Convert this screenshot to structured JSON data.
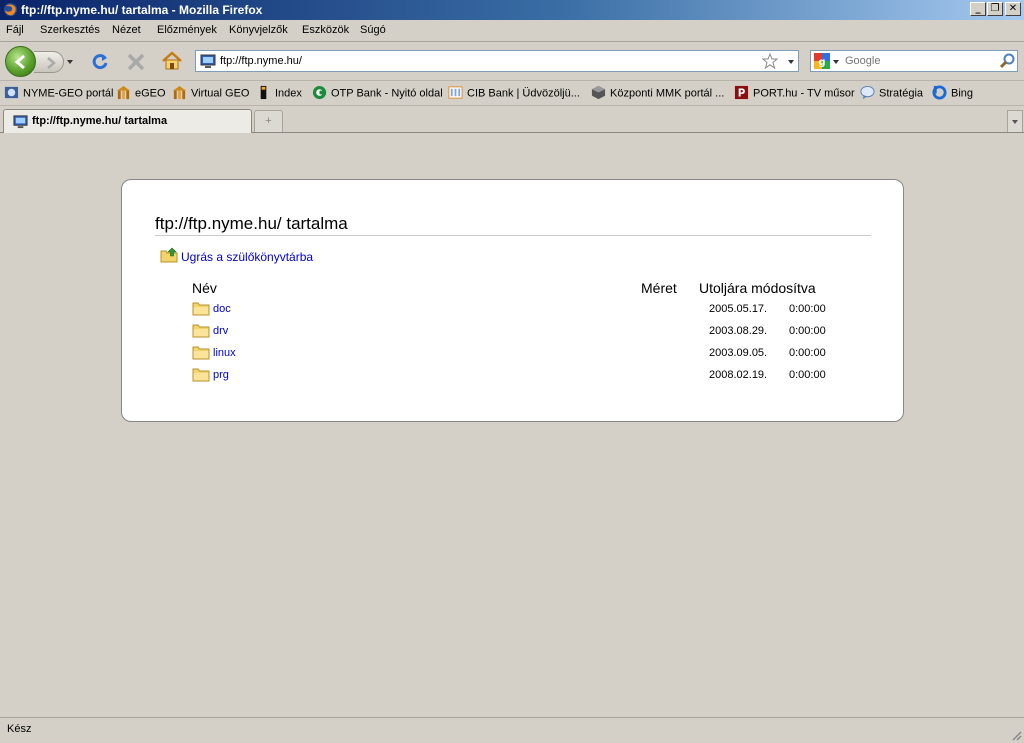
{
  "window": {
    "title": "ftp://ftp.nyme.hu/ tartalma - Mozilla Firefox",
    "minimize_glyph": "_",
    "restore_glyph": "❐",
    "close_glyph": "✕"
  },
  "menu": {
    "items": [
      "Fájl",
      "Szerkesztés",
      "Nézet",
      "Előzmények",
      "Könyvjelzők",
      "Eszközök",
      "Súgó"
    ]
  },
  "nav": {
    "url": "ftp://ftp.nyme.hu/",
    "search_placeholder": "Google",
    "icons": [
      "back-arrow-icon",
      "forward-arrow-icon",
      "reload-icon",
      "stop-icon",
      "home-icon",
      "star-icon",
      "magnifier-icon"
    ]
  },
  "bookmarks": [
    {
      "label": "NYME-GEO portál",
      "icon": "globe-icon"
    },
    {
      "label": "eGEO",
      "icon": "gate-icon"
    },
    {
      "label": "Virtual GEO",
      "icon": "gate-icon"
    },
    {
      "label": "Index",
      "icon": "index-icon"
    },
    {
      "label": "OTP Bank - Nyitó oldal",
      "icon": "otp-icon"
    },
    {
      "label": "CIB Bank | Üdvözöljü...",
      "icon": "cib-icon"
    },
    {
      "label": "Központi MMK portál ...",
      "icon": "cube-icon"
    },
    {
      "label": "PORT.hu - TV műsor",
      "icon": "port-icon"
    },
    {
      "label": "Stratégia",
      "icon": "chat-icon"
    },
    {
      "label": "Bing",
      "icon": "bing-icon"
    }
  ],
  "tabs": {
    "active_label": "ftp://ftp.nyme.hu/ tartalma",
    "new_tab_glyph": "+"
  },
  "listing": {
    "heading": "ftp://ftp.nyme.hu/ tartalma",
    "parent_link": "Ugrás a szülőkönyvtárba",
    "columns": {
      "name": "Név",
      "size": "Méret",
      "modified": "Utoljára módosítva"
    },
    "rows": [
      {
        "name": "doc",
        "date": "2005.05.17.",
        "time": "0:00:00"
      },
      {
        "name": "drv",
        "date": "2003.08.29.",
        "time": "0:00:00"
      },
      {
        "name": "linux",
        "date": "2003.09.05.",
        "time": "0:00:00"
      },
      {
        "name": "prg",
        "date": "2008.02.19.",
        "time": "0:00:00"
      }
    ]
  },
  "status": {
    "text": "Kész"
  },
  "colors": {
    "link": "#0000cc",
    "chrome": "#d4d0c8",
    "titlebar_start": "#0a246a"
  }
}
